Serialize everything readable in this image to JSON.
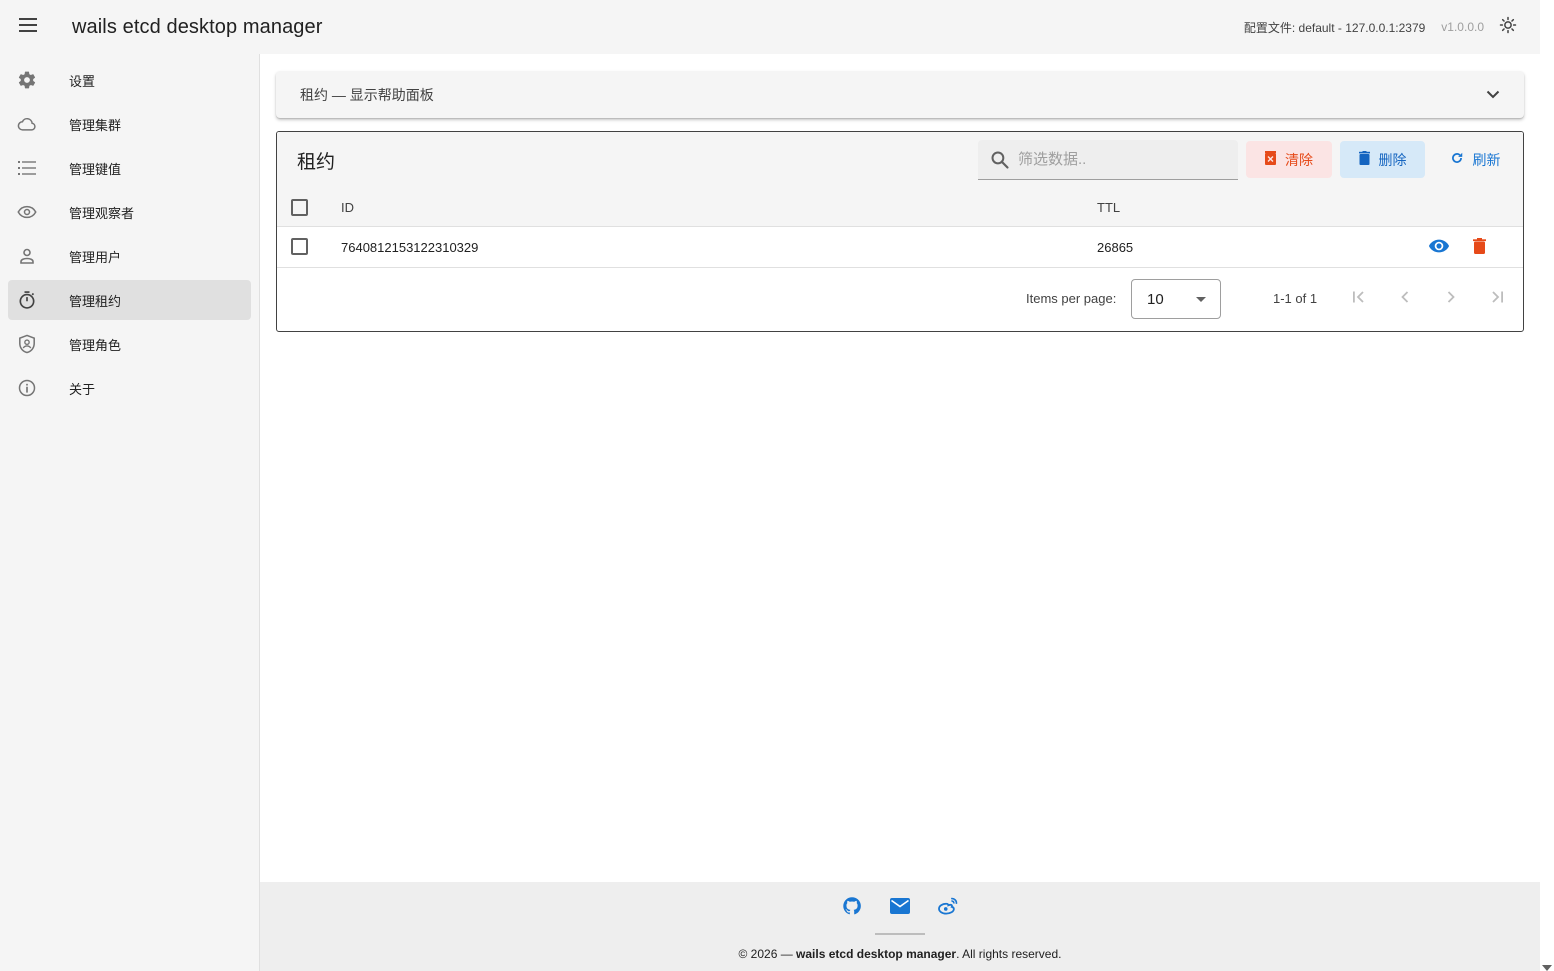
{
  "header": {
    "title": "wails etcd desktop manager",
    "profile": "配置文件: default - 127.0.0.1:2379",
    "version": "v1.0.0.0",
    "icons": {
      "menu": "menu-icon",
      "theme": "brightness-icon"
    }
  },
  "sidebar": {
    "items": [
      {
        "label": "设置",
        "icon": "gear-icon",
        "active": false
      },
      {
        "label": "管理集群",
        "icon": "cloud-icon",
        "active": false
      },
      {
        "label": "管理键值",
        "icon": "list-icon",
        "active": false
      },
      {
        "label": "管理观察者",
        "icon": "eye-icon",
        "active": false
      },
      {
        "label": "管理用户",
        "icon": "user-icon",
        "active": false
      },
      {
        "label": "管理租约",
        "icon": "timer-icon",
        "active": true
      },
      {
        "label": "管理角色",
        "icon": "shield-account-icon",
        "active": false
      },
      {
        "label": "关于",
        "icon": "info-icon",
        "active": false
      }
    ]
  },
  "help_panel": {
    "label": "租约 — 显示帮助面板"
  },
  "leases": {
    "title": "租约",
    "search_placeholder": "筛选数据..",
    "buttons": {
      "clear": "清除",
      "delete": "删除",
      "refresh": "刷新"
    },
    "columns": [
      "ID",
      "TTL"
    ],
    "rows": [
      {
        "id": "7640812153122310329",
        "ttl": "26865"
      }
    ],
    "footer": {
      "items_per_page_label": "Items per page:",
      "items_per_page_value": "10",
      "range": "1-1 of 1"
    }
  },
  "footer": {
    "year_prefix": "© 2026 — ",
    "app_name": "wails etcd desktop manager",
    "suffix": ". All rights reserved.",
    "icons": [
      "github-icon",
      "email-icon",
      "weibo-icon"
    ]
  },
  "colors": {
    "accent": "#1976d2",
    "danger": "#e64a19",
    "surface": "#f5f5f5"
  }
}
